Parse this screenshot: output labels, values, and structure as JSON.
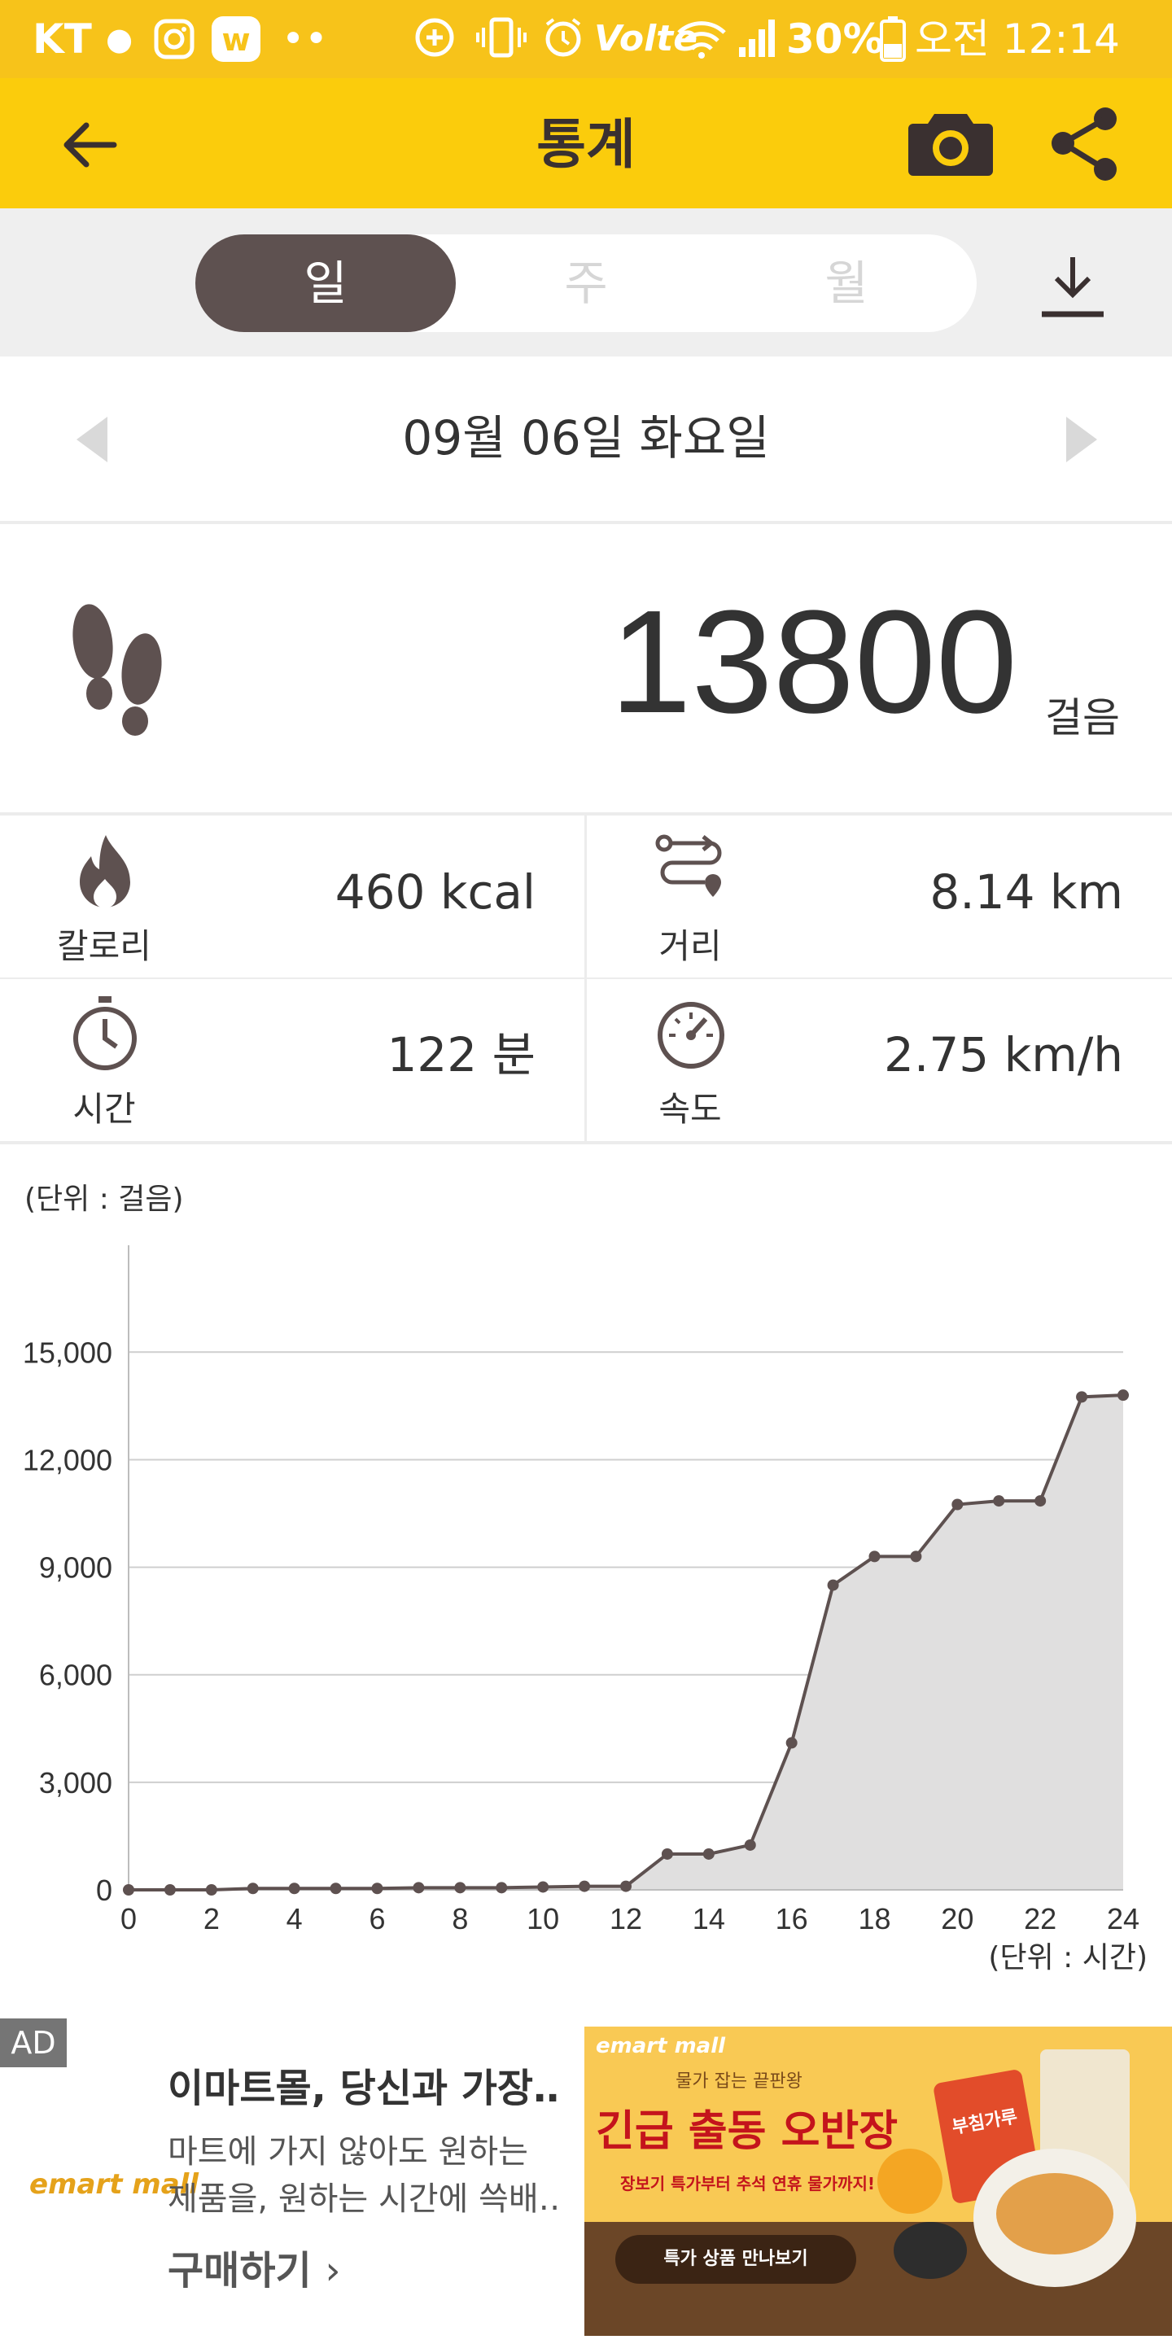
{
  "status_bar": {
    "carrier": "KT",
    "volte": "Volte",
    "battery": "30%",
    "time": "오전 12:14"
  },
  "header": {
    "title": "통계"
  },
  "tabs": [
    "일",
    "주",
    "월"
  ],
  "active_tab": "일",
  "date": {
    "label": "09월 06일 화요일"
  },
  "steps": {
    "value": "13800",
    "unit": "걸음"
  },
  "stats": {
    "calories": {
      "label": "칼로리",
      "value": "460 kcal"
    },
    "distance": {
      "label": "거리",
      "value": "8.14 km"
    },
    "time": {
      "label": "시간",
      "value": "122 분"
    },
    "speed": {
      "label": "속도",
      "value": "2.75 km/h"
    }
  },
  "colors": {
    "accent": "#fbcc0c",
    "dark": "#5e5150",
    "chart_fill": "#e0dfdf"
  },
  "chart_data": {
    "type": "area",
    "x": [
      0,
      1,
      2,
      3,
      4,
      5,
      6,
      7,
      8,
      9,
      10,
      11,
      12,
      13,
      14,
      15,
      16,
      17,
      18,
      19,
      20,
      21,
      22,
      23,
      24
    ],
    "values": [
      0,
      0,
      0,
      40,
      40,
      40,
      40,
      60,
      60,
      60,
      80,
      100,
      100,
      1000,
      1000,
      1250,
      4100,
      8500,
      9300,
      9300,
      10750,
      10850,
      10850,
      13750,
      13800
    ],
    "y_ticks": [
      "0",
      "3,000",
      "6,000",
      "9,000",
      "12,000",
      "15,000"
    ],
    "x_ticks": [
      "0",
      "2",
      "4",
      "6",
      "8",
      "10",
      "12",
      "14",
      "16",
      "18",
      "20",
      "22",
      "24"
    ],
    "ylim": [
      0,
      17300
    ],
    "xlim": [
      0,
      24
    ],
    "ylabel": "(단위 : 걸음)",
    "xlabel": "(단위 : 시간)",
    "grid": true
  },
  "ad": {
    "badge": "AD",
    "brand": "emart mall",
    "title": "이마트몰, 당신과 가장…",
    "desc_line1": "마트에 가지 않아도 원하는",
    "desc_line2": "제품을, 원하는 시간에 쓱배…",
    "cta": "구매하기",
    "banner_brand": "emart mall",
    "banner_headline": "물가 잡는 끝판왕",
    "banner_title": "긴급 출동 오반장",
    "banner_sub": "장보기 특가부터 추석 연휴 물가까지!",
    "banner_button": "특가 상품 만나보기",
    "banner_product": "부침가루"
  }
}
